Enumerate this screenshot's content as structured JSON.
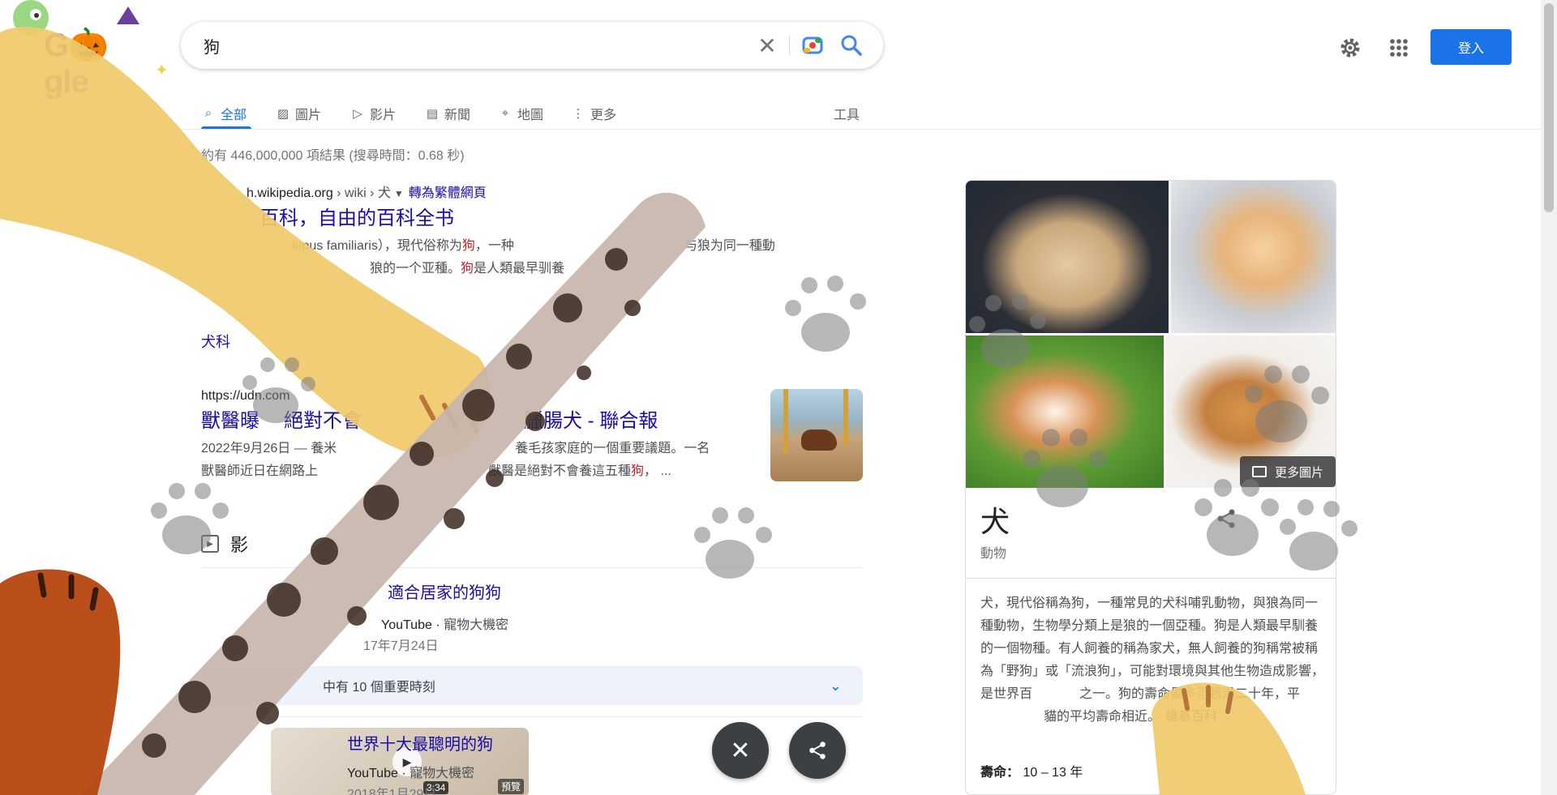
{
  "search": {
    "query": "狗",
    "clear_label": "✕"
  },
  "logo": {
    "text_g": "G",
    "text_rest": "gle"
  },
  "header": {
    "signin_label": "登入"
  },
  "tabs": [
    {
      "label": "全部",
      "icon": "search-icon"
    },
    {
      "label": "圖片",
      "icon": "image-icon"
    },
    {
      "label": "影片",
      "icon": "video-icon"
    },
    {
      "label": "新聞",
      "icon": "news-icon"
    },
    {
      "label": "地圖",
      "icon": "map-pin-icon"
    },
    {
      "label": "更多",
      "icon": "more-vert-icon"
    }
  ],
  "tools_label": "工具",
  "result_stats": "約有 446,000,000 項結果 (搜尋時間：0.68 秒)",
  "results": [
    {
      "cite_host": "h.wikipedia.org",
      "cite_path": " › wiki › 犬",
      "translate": "轉為繁體網頁",
      "title": "百科，自由的百科全书",
      "snippet_1": "lupus familiaris），現代俗称为狗，一种",
      "snippet_2": "与狼为同一種動",
      "snippet_3": "狼的一个亚種。狗是人類最早驯養",
      "sitelink": "犬科"
    },
    {
      "cite_host": "https://udn.com",
      "title_a": "獸醫曝",
      "title_b": "絕對不會",
      "title_c": "臘腸犬 - 聯合報",
      "snippet_1": "2022年9月26日 — 養米",
      "snippet_2": "養毛孩家庭的一個重要議題。一名",
      "snippet_3": "獸醫師近日在網路上",
      "snippet_4": "獸醫是絕對不會養這五種狗， ..."
    }
  ],
  "videos": {
    "heading": "影",
    "items": [
      {
        "title": "適合居家的狗狗",
        "source": "YouTube",
        "channel": "寵物大機密",
        "date": "17年7月24日"
      },
      {
        "title": "世界十大最聰明的狗",
        "source": "YouTube",
        "channel": "寵物大機密",
        "date": "2018年1月29日",
        "duration": "3:34",
        "preview": "預覽"
      }
    ],
    "moments": "中有 10 個重要時刻"
  },
  "knowledge_panel": {
    "title": "犬",
    "subtitle": "動物",
    "more_images": "更多圖片",
    "description": "犬，現代俗稱為狗，一種常見的犬科哺乳動物，與狼為同一種動物，生物學分類上是狼的一個亞種。狗是人類最早馴養的一個物種。有人飼養的稱為家犬，無人飼養的狗稱常被稱為「野狗」或「流浪狗」，可能對環境與其他生物造成影響，是世界百",
    "description_tail": "之一。狗的壽命最多可超過二十年，平",
    "description_tail2": "貓的平均壽命相近。",
    "source_link": "維基百科",
    "life_label": "壽命：",
    "life_value": "10 – 13 年"
  },
  "colors": {
    "accent": "#1a73e8",
    "link": "#1a0dab",
    "highlight": "#c5221f"
  }
}
